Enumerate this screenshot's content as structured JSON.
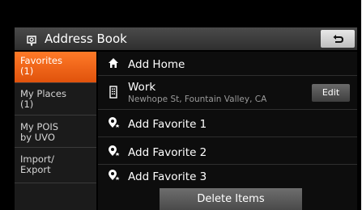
{
  "header": {
    "title": "Address Book",
    "back_icon": "back-arrow-icon"
  },
  "sidebar": {
    "items": [
      {
        "label": "Favorites\n(1)",
        "active": true
      },
      {
        "label": "My Places\n(1)",
        "active": false
      },
      {
        "label": "My POIS\nby UVO",
        "active": false
      },
      {
        "label": "Import/\nExport",
        "active": false
      }
    ]
  },
  "list": {
    "rows": [
      {
        "label": "Add Home",
        "icon": "home-icon"
      },
      {
        "label": "Work",
        "sub": "Newhope St, Fountain Valley, CA",
        "icon": "building-icon",
        "edit_label": "Edit"
      },
      {
        "label": "Add Favorite 1",
        "icon": "favorite-pin-icon"
      },
      {
        "label": "Add Favorite 2",
        "icon": "favorite-pin-icon"
      },
      {
        "label": "Add Favorite 3",
        "icon": "favorite-pin-icon"
      }
    ]
  },
  "footer": {
    "delete_label": "Delete Items"
  },
  "colors": {
    "accent": "#f26a1b",
    "background": "#000000"
  }
}
